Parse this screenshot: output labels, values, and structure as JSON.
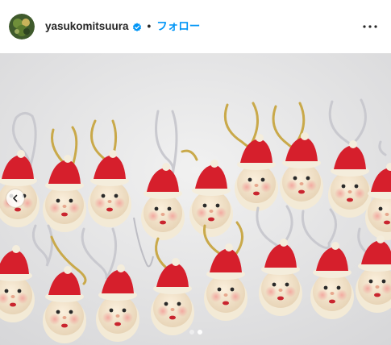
{
  "header": {
    "username": "yasukomitsuura",
    "verified_icon": "verified-badge-icon",
    "separator": "•",
    "follow_label": "フォロー",
    "more_icon": "more-options-icon",
    "avatar_icon": "profile-avatar"
  },
  "media": {
    "photo_subject": "felt-santa-ornaments-photo",
    "prev_icon": "chevron-left-icon",
    "slide_count": 2,
    "active_slide": 2
  },
  "colors": {
    "accent": "#0095f6",
    "text": "#262626",
    "verified": "#0095f6"
  }
}
